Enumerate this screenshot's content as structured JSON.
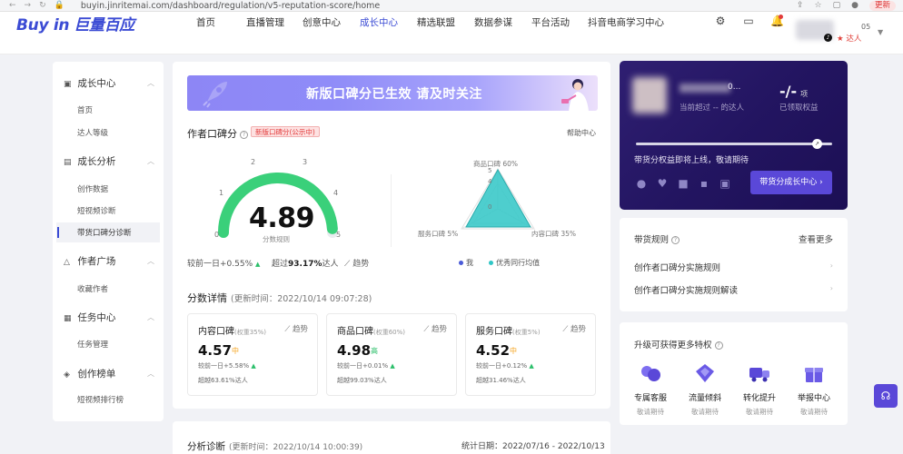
{
  "browser": {
    "url": "buyin.jinritemai.com/dashboard/regulation/v5-reputation-score/home",
    "update_label": "更新"
  },
  "header": {
    "logo_en": "Buy in",
    "logo_cn": "巨量百应",
    "nav": [
      "首页",
      "直播管理",
      "创意中心",
      "成长中心",
      "精选联盟",
      "数据参谋",
      "平台活动",
      "抖音电商学习中心"
    ],
    "active_nav": "成长中心",
    "badge_count": "05",
    "badge_label": "达人"
  },
  "sidebar": {
    "groups": [
      {
        "title": "成长中心",
        "items": [
          "首页",
          "达人等级"
        ]
      },
      {
        "title": "成长分析",
        "items": [
          "创作数据",
          "短视频诊断",
          "带货口碑分诊断"
        ]
      },
      {
        "title": "作者广场",
        "items": [
          "收藏作者"
        ]
      },
      {
        "title": "任务中心",
        "items": [
          "任务管理"
        ]
      },
      {
        "title": "创作榜单",
        "items": [
          "短视频排行榜"
        ]
      }
    ]
  },
  "banner": {
    "text": "新版口碑分已生效 请及时关注"
  },
  "score": {
    "title": "作者口碑分",
    "tag": "新版口碑分(公示中)",
    "help": "帮助中心",
    "value": "4.89",
    "value_num": 4.89,
    "rule_label": "分数规则",
    "gauge_ticks": [
      "0",
      "1",
      "2",
      "3",
      "4",
      "5"
    ],
    "compare_day_label": "较前一日",
    "compare_day_value": "+0.55%",
    "beyond_label": "超过",
    "beyond_value": "93.17%",
    "beyond_suffix": "达人",
    "trend_label": "趋势"
  },
  "radar": {
    "labels": [
      "商品口碑 60%",
      "服务口碑 5%",
      "内容口碑 35%"
    ],
    "ticks": [
      "5",
      "4",
      "0"
    ],
    "legend_me": "我",
    "legend_peer": "优秀同行均值"
  },
  "details": {
    "title": "分数详情",
    "time": "(更新时间：2022/10/14 09:07:28)",
    "cards": [
      {
        "name": "内容口碑",
        "weight": "(权重35%)",
        "trend": "趋势",
        "score": "4.57",
        "level": "中",
        "level_color": "#f5a623",
        "change": "较前一日+5.58%",
        "beyond": "超越63.61%达人"
      },
      {
        "name": "商品口碑",
        "weight": "(权重60%)",
        "trend": "趋势",
        "score": "4.98",
        "level": "高",
        "level_color": "#2bbf6a",
        "change": "较前一日+0.01%",
        "beyond": "超越99.03%达人"
      },
      {
        "name": "服务口碑",
        "weight": "(权重5%)",
        "trend": "趋势",
        "score": "4.52",
        "level": "中",
        "level_color": "#f5a623",
        "change": "较前一日+0.12%",
        "beyond": "超越31.46%达人"
      }
    ]
  },
  "analysis": {
    "title": "分析诊断",
    "time": "(更新时间：2022/10/14 10:00:39)",
    "date_range": "统计日期：2022/07/16 - 2022/10/13"
  },
  "benefit": {
    "zero": "0...",
    "beyond": "当前超过 -- 的达人",
    "count": "-/-",
    "count_unit": "项",
    "claimed": "已领取权益",
    "message": "带货分权益即将上线，敬请期待",
    "button": "带货分成长中心"
  },
  "rules": {
    "title": "带货规则",
    "more": "查看更多",
    "items": [
      "创作者口碑分实施规则",
      "创作者口碑分实施规则解读"
    ]
  },
  "privileges": {
    "title": "升级可获得更多特权",
    "items": [
      {
        "label": "专属客服",
        "sub": "敬请期待",
        "icon": "headset-icon"
      },
      {
        "label": "流量倾斜",
        "sub": "敬请期待",
        "icon": "traffic-icon"
      },
      {
        "label": "转化提升",
        "sub": "敬请期待",
        "icon": "truck-icon"
      },
      {
        "label": "举报中心",
        "sub": "敬请期待",
        "icon": "gift-icon"
      }
    ]
  },
  "colors": {
    "brand": "#3b4bd4",
    "accent_purple": "#5a48d8",
    "gauge_green": "#3ad07a",
    "radar_teal": "#2fc6c6"
  }
}
